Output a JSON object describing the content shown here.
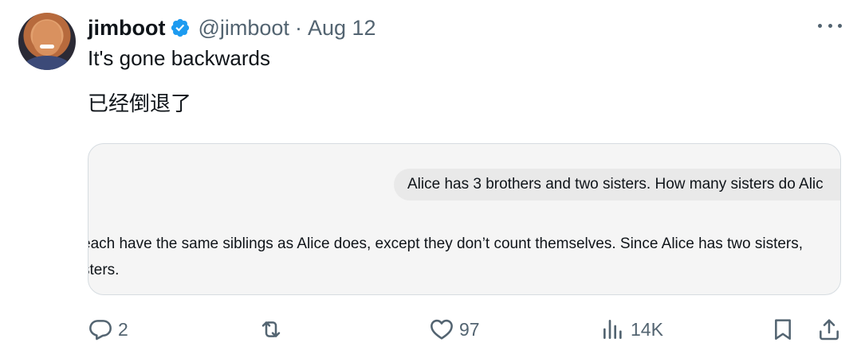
{
  "tweet": {
    "display_name": "jimboot",
    "handle": "@jimboot",
    "separator": "·",
    "date": "Aug 12",
    "text_line1": "It's gone backwards",
    "text_line2": "已经倒退了",
    "verified": true
  },
  "card": {
    "question": "Alice has 3 brothers and two sisters. How many sisters do Alic",
    "answer_line1": "each have the same siblings as Alice does, except they don’t count themselves. Since Alice has two sisters,",
    "answer_line2": "sters."
  },
  "actions": {
    "replies": "2",
    "retweets": "",
    "likes": "97",
    "views": "14K"
  },
  "icons": {
    "verified_color": "#1d9bf0",
    "action_color": "#536471"
  }
}
